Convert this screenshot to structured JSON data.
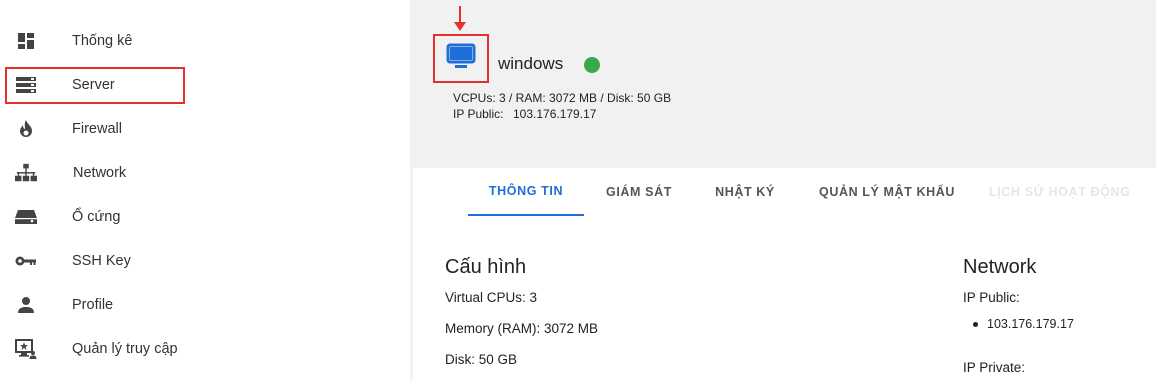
{
  "sidebar": {
    "items": [
      {
        "label": "Thống kê",
        "icon": "dashboard-icon"
      },
      {
        "label": "Server",
        "icon": "server-icon"
      },
      {
        "label": "Firewall",
        "icon": "flame-icon"
      },
      {
        "label": "Network",
        "icon": "network-icon"
      },
      {
        "label": "Ổ cứng",
        "icon": "hard-drive-icon"
      },
      {
        "label": "SSH Key",
        "icon": "key-icon"
      },
      {
        "label": "Profile",
        "icon": "person-icon"
      },
      {
        "label": "Quản lý truy cập",
        "icon": "access-management-icon"
      }
    ]
  },
  "server": {
    "name": "windows",
    "icon": "monitor-icon",
    "status_color": "#3aa846",
    "specs_line": "VCPUs: 3 / RAM: 3072 MB / Disk: 50 GB",
    "ip_label": "IP Public:",
    "ip_value": "103.176.179.17"
  },
  "tabs": [
    {
      "label": "THÔNG TIN",
      "active": true
    },
    {
      "label": "GIÁM SÁT"
    },
    {
      "label": "NHẬT KÝ"
    },
    {
      "label": "QUẢN LÝ MẬT KHẨU"
    },
    {
      "label": "LỊCH SỬ HOẠT ĐỘNG"
    }
  ],
  "config": {
    "title": "Cấu hình",
    "vcpus": "Virtual CPUs: 3",
    "memory": "Memory (RAM): 3072 MB",
    "disk": "Disk: 50 GB"
  },
  "network": {
    "title": "Network",
    "ip_public_label": "IP Public:",
    "ip_public_value": "103.176.179.17",
    "ip_private_label": "IP Private:"
  },
  "colors": {
    "accent": "#1e6fd9",
    "annotation_red": "#e53030",
    "status_green": "#3aa846"
  }
}
